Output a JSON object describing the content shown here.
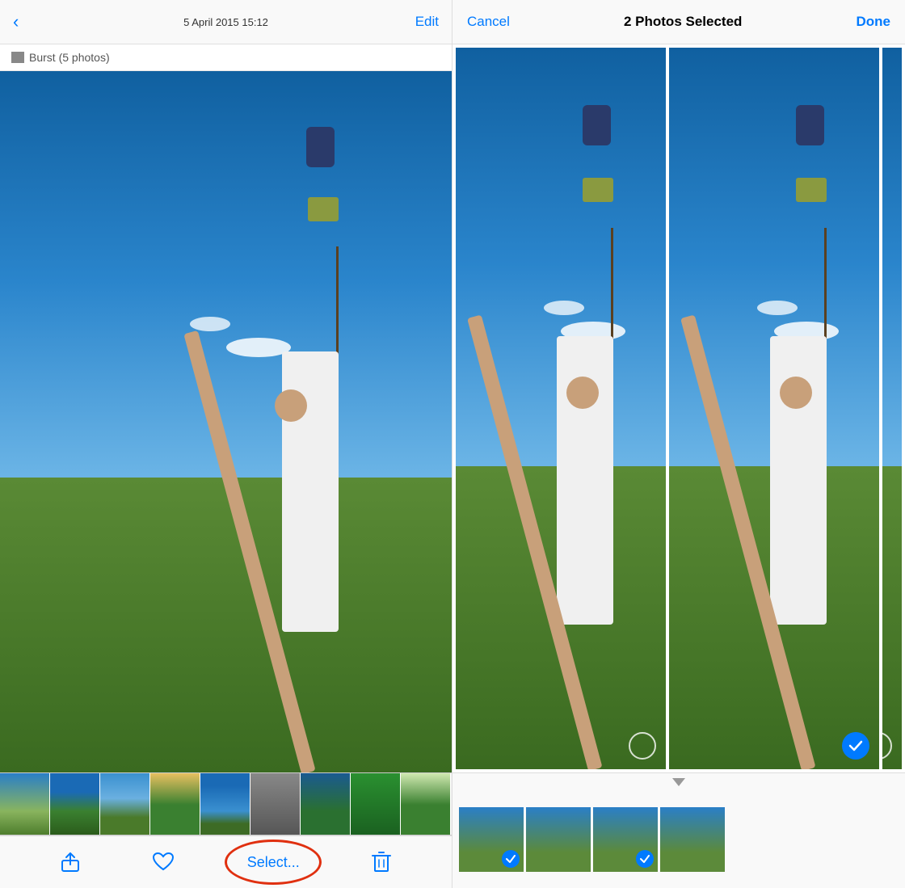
{
  "left": {
    "header": {
      "back_label": "‹",
      "date_time": "5 April 2015  15:12",
      "edit_label": "Edit"
    },
    "burst_label": "Burst (5 photos)",
    "thumbnails": [
      {
        "color": "tb1"
      },
      {
        "color": "tb2"
      },
      {
        "color": "tb3"
      },
      {
        "color": "tb4"
      },
      {
        "color": "tb5"
      },
      {
        "color": "tb6"
      },
      {
        "color": "tb7"
      },
      {
        "color": "tb8"
      },
      {
        "color": "tb9"
      }
    ],
    "toolbar": {
      "share_icon": "↑",
      "heart_icon": "♡",
      "select_label": "Select...",
      "trash_icon": "🗑"
    }
  },
  "right": {
    "header": {
      "cancel_label": "Cancel",
      "title": "2 Photos Selected",
      "done_label": "Done"
    },
    "thumbnails": [
      {
        "selected": true,
        "color": "tb1"
      },
      {
        "selected": false,
        "color": "tb3"
      },
      {
        "selected": true,
        "color": "tb5"
      },
      {
        "selected": false,
        "color": "tb7"
      }
    ]
  }
}
